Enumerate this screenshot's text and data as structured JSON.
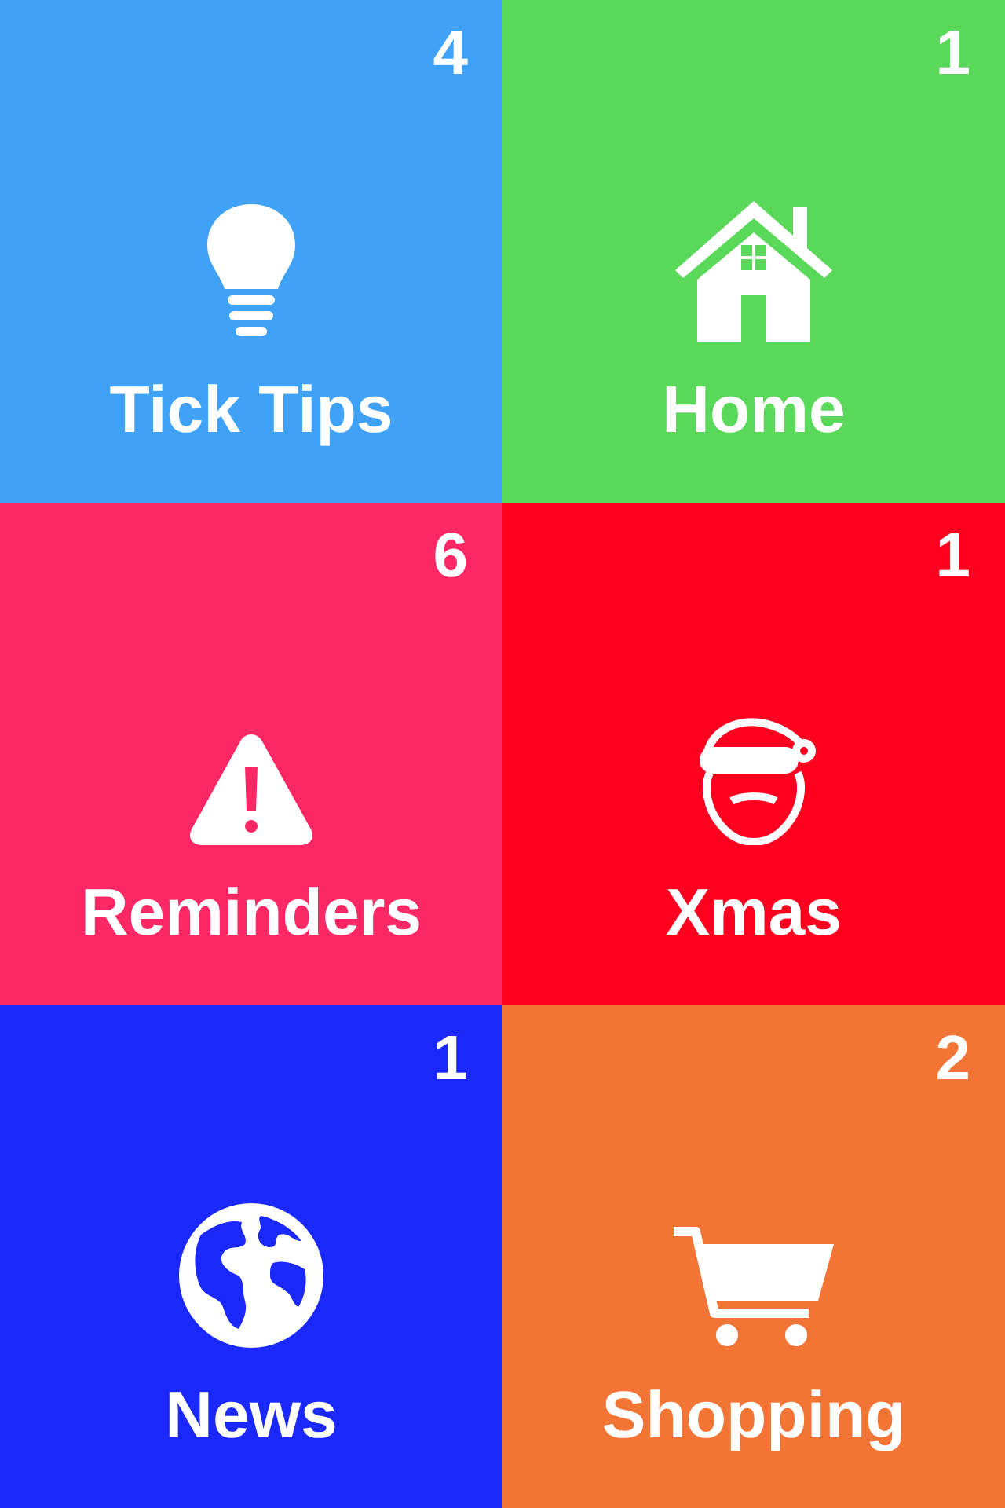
{
  "tiles": [
    {
      "label": "Tick Tips",
      "count": "4",
      "color": "#3fa2f7",
      "kind": "bulb"
    },
    {
      "label": "Home",
      "count": "1",
      "color": "#5ad85a",
      "kind": "house"
    },
    {
      "label": "Reminders",
      "count": "6",
      "color": "#fc2765",
      "kind": "warning"
    },
    {
      "label": "Xmas",
      "count": "1",
      "color": "#ff0020",
      "kind": "santa"
    },
    {
      "label": "News",
      "count": "1",
      "color": "#1a28fc",
      "kind": "globe"
    },
    {
      "label": "Shopping",
      "count": "2",
      "color": "#f37535",
      "kind": "cart"
    }
  ]
}
